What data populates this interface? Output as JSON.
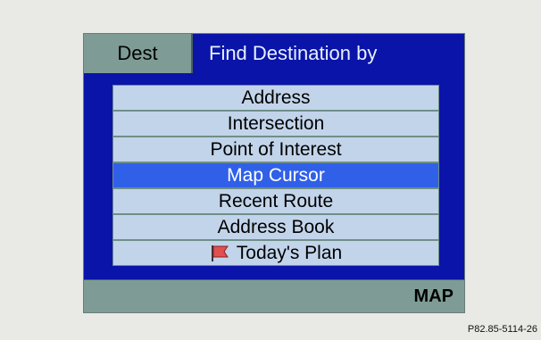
{
  "header": {
    "dest_tab": "Dest",
    "title": "Find Destination by"
  },
  "menu": {
    "items": [
      {
        "label": "Address",
        "selected": false
      },
      {
        "label": "Intersection",
        "selected": false
      },
      {
        "label": "Point of Interest",
        "selected": false
      },
      {
        "label": "Map Cursor",
        "selected": true
      },
      {
        "label": "Recent Route",
        "selected": false
      },
      {
        "label": "Address Book",
        "selected": false
      },
      {
        "label": "Today's Plan",
        "selected": false,
        "icon": "flag-icon"
      }
    ]
  },
  "footer": {
    "map_label": "MAP"
  },
  "reference_code": "P82.85-5114-26",
  "colors": {
    "screen_bg": "#0a14a8",
    "item_bg": "#c2d4ea",
    "selected_bg": "#3060e8",
    "tab_bg": "#7e9c95",
    "flag": "#e05050"
  }
}
